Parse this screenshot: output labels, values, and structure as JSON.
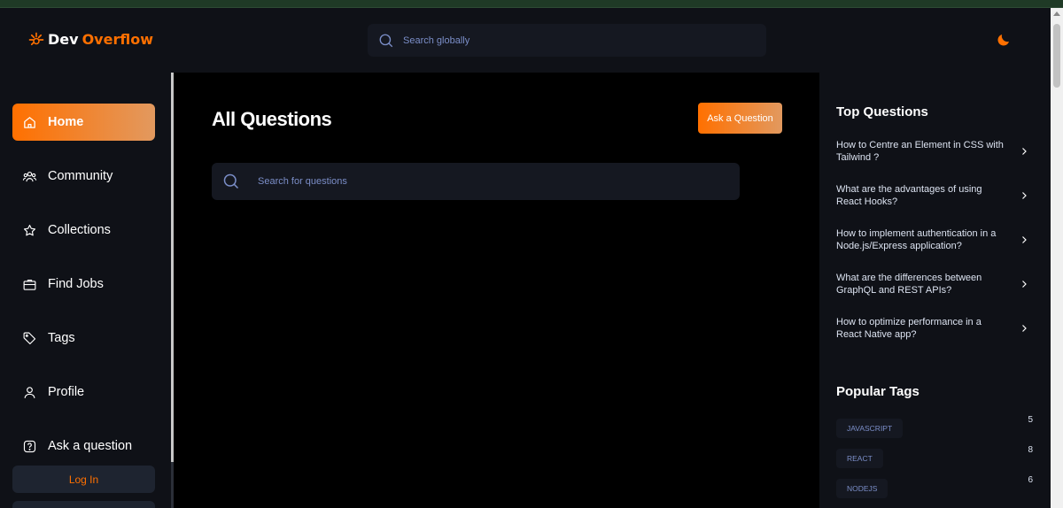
{
  "brand": {
    "prefix": "Dev",
    "suffix": "Overflow",
    "accent": "#ff7000"
  },
  "header": {
    "search_placeholder": "Search globally",
    "theme_icon": "moon-icon"
  },
  "sidebar": {
    "items": [
      {
        "label": "Home",
        "icon": "home-icon",
        "active": true
      },
      {
        "label": "Community",
        "icon": "community-icon"
      },
      {
        "label": "Collections",
        "icon": "star-icon"
      },
      {
        "label": "Find Jobs",
        "icon": "briefcase-icon"
      },
      {
        "label": "Tags",
        "icon": "tag-icon"
      },
      {
        "label": "Profile",
        "icon": "user-icon"
      },
      {
        "label": "Ask a question",
        "icon": "question-icon"
      }
    ],
    "login_label": "Log In"
  },
  "main": {
    "title": "All Questions",
    "ask_button": "Ask a Question",
    "search_placeholder": "Search for questions"
  },
  "rightbar": {
    "top_questions_title": "Top Questions",
    "top_questions": [
      "How to Centre an Element in CSS with Tailwind ?",
      "What are the advantages of using React Hooks?",
      "How to implement authentication in a Node.js/Express application?",
      "What are the differences between GraphQL and REST APIs?",
      "How to optimize performance in a React Native app?"
    ],
    "popular_tags_title": "Popular Tags",
    "popular_tags": [
      {
        "name": "JAVASCRIPT",
        "count": "5"
      },
      {
        "name": "REACT",
        "count": "8"
      },
      {
        "name": "NODEJS",
        "count": "6"
      }
    ]
  }
}
